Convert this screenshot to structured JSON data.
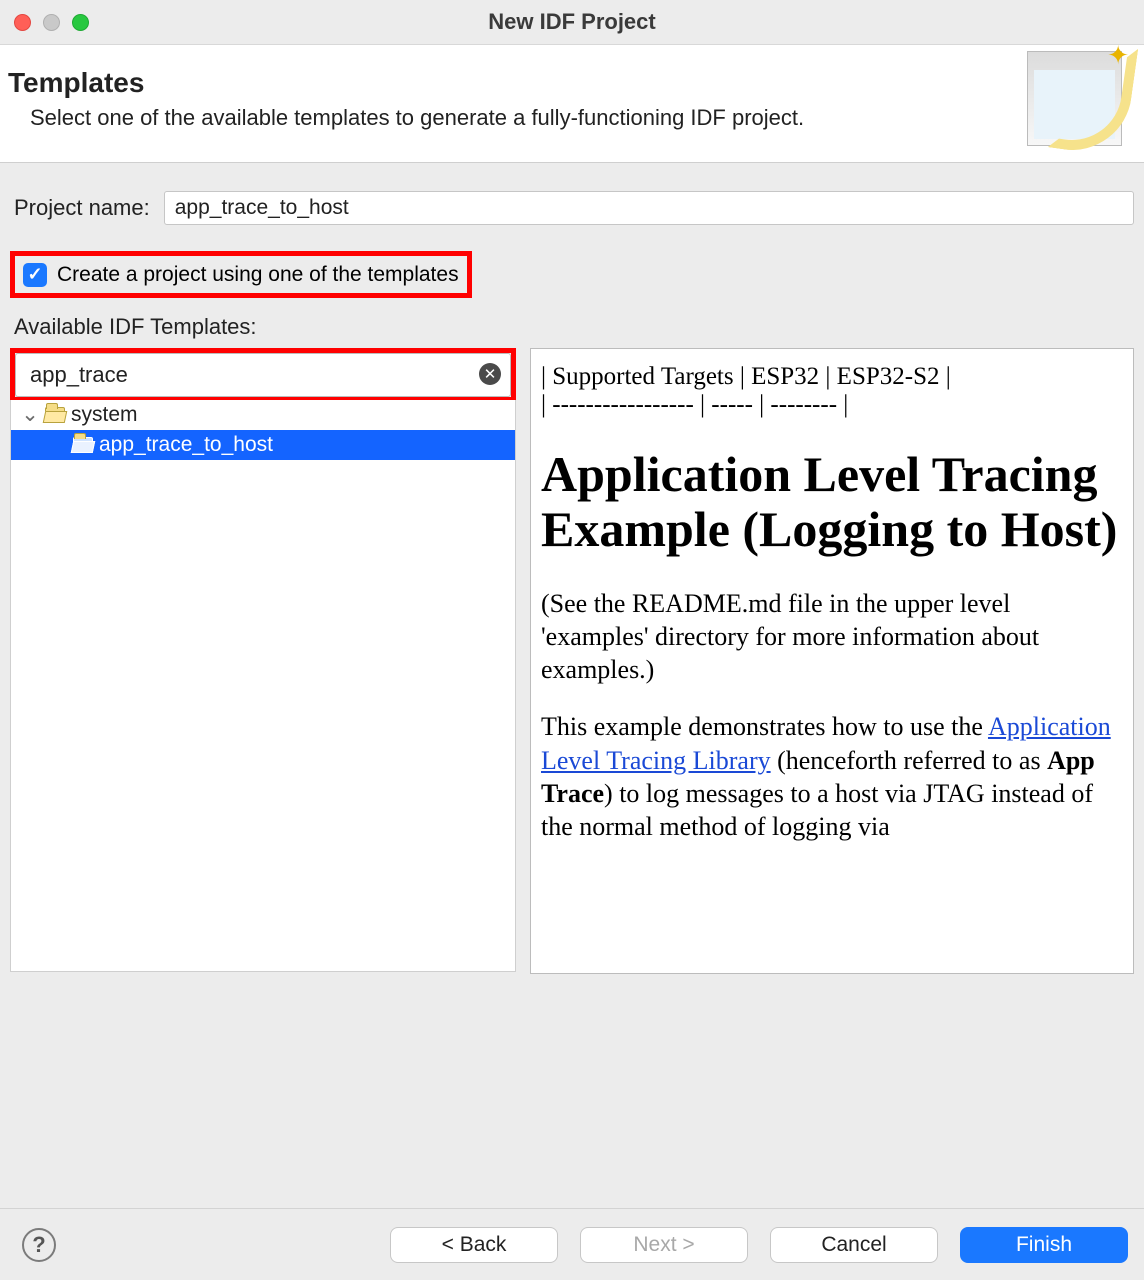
{
  "window": {
    "title": "New IDF Project"
  },
  "header": {
    "title": "Templates",
    "description": "Select one of the available templates to generate a fully-functioning IDF project."
  },
  "form": {
    "project_name_label": "Project name:",
    "project_name_value": "app_trace_to_host",
    "use_template_label": "Create a project using one of the templates",
    "use_template_checked": true,
    "available_label": "Available IDF Templates:",
    "search_value": "app_trace"
  },
  "tree": {
    "parent": {
      "label": "system",
      "expanded": true
    },
    "child": {
      "label": "app_trace_to_host",
      "selected": true
    }
  },
  "preview": {
    "targets_line": "| Supported Targets | ESP32 | ESP32-S2 |",
    "dash_line": "| ----------------- | ----- | -------- |",
    "heading": "Application Level Tracing Example (Logging to Host)",
    "p1": "(See the README.md file in the upper level 'examples' directory for more information about examples.)",
    "p2_pre": "This example demonstrates how to use the ",
    "p2_link": "Application Level Tracing Library",
    "p2_mid": " (henceforth referred to as ",
    "p2_bold": "App Trace",
    "p2_post": ") to log messages to a host via JTAG instead of the normal method of logging via"
  },
  "footer": {
    "back": "< Back",
    "next": "Next >",
    "cancel": "Cancel",
    "finish": "Finish"
  }
}
